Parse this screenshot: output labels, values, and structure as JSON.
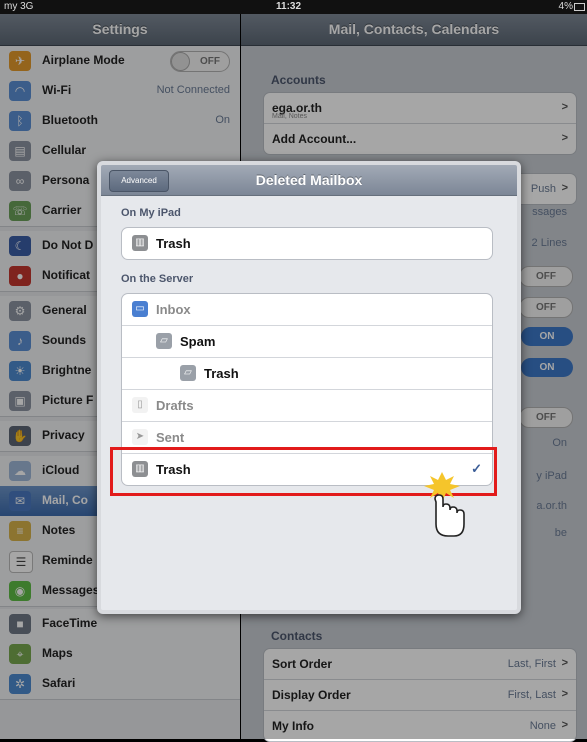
{
  "status_bar": {
    "carrier": "my 3G",
    "time": "11:32",
    "battery": "4%"
  },
  "sidebar": {
    "title": "Settings",
    "items": [
      {
        "label": "Airplane Mode",
        "value": "OFF",
        "icon": "airplane-icon",
        "color": "#e49a2c",
        "kind": "toggle"
      },
      {
        "label": "Wi-Fi",
        "value": "Not Connected",
        "icon": "wifi-icon",
        "color": "#5b8fd5"
      },
      {
        "label": "Bluetooth",
        "value": "On",
        "icon": "bluetooth-icon",
        "color": "#5b8fd5"
      },
      {
        "label": "Cellular",
        "value": "",
        "icon": "cellular-icon",
        "color": "#8c94a2"
      },
      {
        "label": "Persona",
        "value": "",
        "icon": "hotspot-icon",
        "color": "#8c94a2"
      },
      {
        "label": "Carrier",
        "value": "",
        "icon": "phone-icon",
        "color": "#6aa05a"
      },
      {
        "label": "Do Not D",
        "value": "",
        "icon": "moon-icon",
        "color": "#3b5fa7"
      },
      {
        "label": "Notificat",
        "value": "",
        "icon": "notification-icon",
        "color": "#c4372f"
      },
      {
        "label": "General",
        "value": "",
        "icon": "gear-icon",
        "color": "#8c94a2"
      },
      {
        "label": "Sounds",
        "value": "",
        "icon": "sound-icon",
        "color": "#5b8fd5"
      },
      {
        "label": "Brightne",
        "value": "",
        "icon": "brightness-icon",
        "color": "#4d8ad0"
      },
      {
        "label": "Picture F",
        "value": "",
        "icon": "picture-frame-icon",
        "color": "#8c94a2"
      },
      {
        "label": "Privacy",
        "value": "",
        "icon": "privacy-hand-icon",
        "color": "#5c6675"
      },
      {
        "label": "iCloud",
        "value": "",
        "icon": "cloud-icon",
        "color": "#9fb7d7"
      },
      {
        "label": "Mail, Co",
        "value": "",
        "icon": "mail-icon",
        "color": "#4a79c0",
        "selected": true
      },
      {
        "label": "Notes",
        "value": "",
        "icon": "notes-icon",
        "color": "#d7b24a"
      },
      {
        "label": "Reminde",
        "value": "",
        "icon": "reminders-icon",
        "color": "#ffffff"
      },
      {
        "label": "Messages",
        "value": "",
        "icon": "messages-icon",
        "color": "#5fbd46"
      },
      {
        "label": "FaceTime",
        "value": "",
        "icon": "facetime-icon",
        "color": "#6f7886"
      },
      {
        "label": "Maps",
        "value": "",
        "icon": "maps-icon",
        "color": "#78a84f"
      },
      {
        "label": "Safari",
        "value": "",
        "icon": "safari-icon",
        "color": "#4d8ad0"
      }
    ]
  },
  "detail": {
    "title": "Mail, Contacts, Calendars",
    "accounts_header": "Accounts",
    "accounts": [
      {
        "label": "ega.or.th",
        "sub": "Mail, Notes"
      },
      {
        "label": "Add Account..."
      }
    ],
    "fetch_value": "Push",
    "partial_rows": [
      "ssages",
      "2 Lines",
      "OFF",
      "OFF",
      "ON",
      "ON",
      "OFF",
      "On",
      "y iPad",
      "a.or.th",
      "be"
    ],
    "contacts_header": "Contacts",
    "contacts": [
      {
        "label": "Sort Order",
        "value": "Last, First"
      },
      {
        "label": "Display Order",
        "value": "First, Last"
      },
      {
        "label": "My Info",
        "value": "None"
      }
    ]
  },
  "popover": {
    "title": "Deleted Mailbox",
    "back_label": "Advanced",
    "section_ipad": "On My iPad",
    "ipad_items": [
      {
        "label": "Trash",
        "icon": "trash-icon"
      }
    ],
    "section_server": "On the Server",
    "server_items": [
      {
        "label": "Inbox",
        "icon": "inbox-icon",
        "disabled": true,
        "indent": 0
      },
      {
        "label": "Spam",
        "icon": "folder-icon",
        "indent": 1
      },
      {
        "label": "Trash",
        "icon": "folder-icon",
        "indent": 2
      },
      {
        "label": "Drafts",
        "icon": "drafts-icon",
        "disabled": true,
        "indent": 0
      },
      {
        "label": "Sent",
        "icon": "sent-icon",
        "disabled": true,
        "indent": 0
      },
      {
        "label": "Trash",
        "icon": "trash-icon",
        "selected": true,
        "indent": 0
      }
    ],
    "check": "✓"
  },
  "colors": {
    "highlight": "#e21b1b",
    "accent": "#3b5d97",
    "selected": "#4a79c0"
  }
}
